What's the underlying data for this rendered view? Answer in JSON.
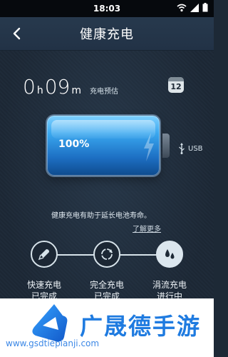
{
  "status": {
    "time": "18:03",
    "icons": [
      "wifi-icon",
      "signal-icon",
      "battery-icon"
    ]
  },
  "header": {
    "title": "健康充电",
    "back_icon": "back-arrow-icon"
  },
  "charge": {
    "hours": "0",
    "hours_unit": "h",
    "minutes": "09",
    "minutes_unit": "m",
    "estimate_label": "充电预估",
    "calendar_day": "12"
  },
  "battery": {
    "percent_label": "100%",
    "level": 1.0,
    "source_label": "USB"
  },
  "tip": "健康充电有助于延长电池寿命。",
  "learn_more": "了解更多",
  "steps": [
    {
      "label": "快速充电",
      "sub": "已完成",
      "icon": "rocket-icon"
    },
    {
      "label": "完全充电",
      "sub": "已完成",
      "icon": "cycle-icon"
    },
    {
      "label": "涓流充电",
      "sub": "进行中",
      "icon": "drops-icon"
    }
  ],
  "banner": {
    "title": "广晟德手游",
    "url": "www.gsdtiepianji.com"
  },
  "colors": {
    "accent": "#1f7be0",
    "battery": "#39a7ef",
    "background": "#1d2936"
  }
}
